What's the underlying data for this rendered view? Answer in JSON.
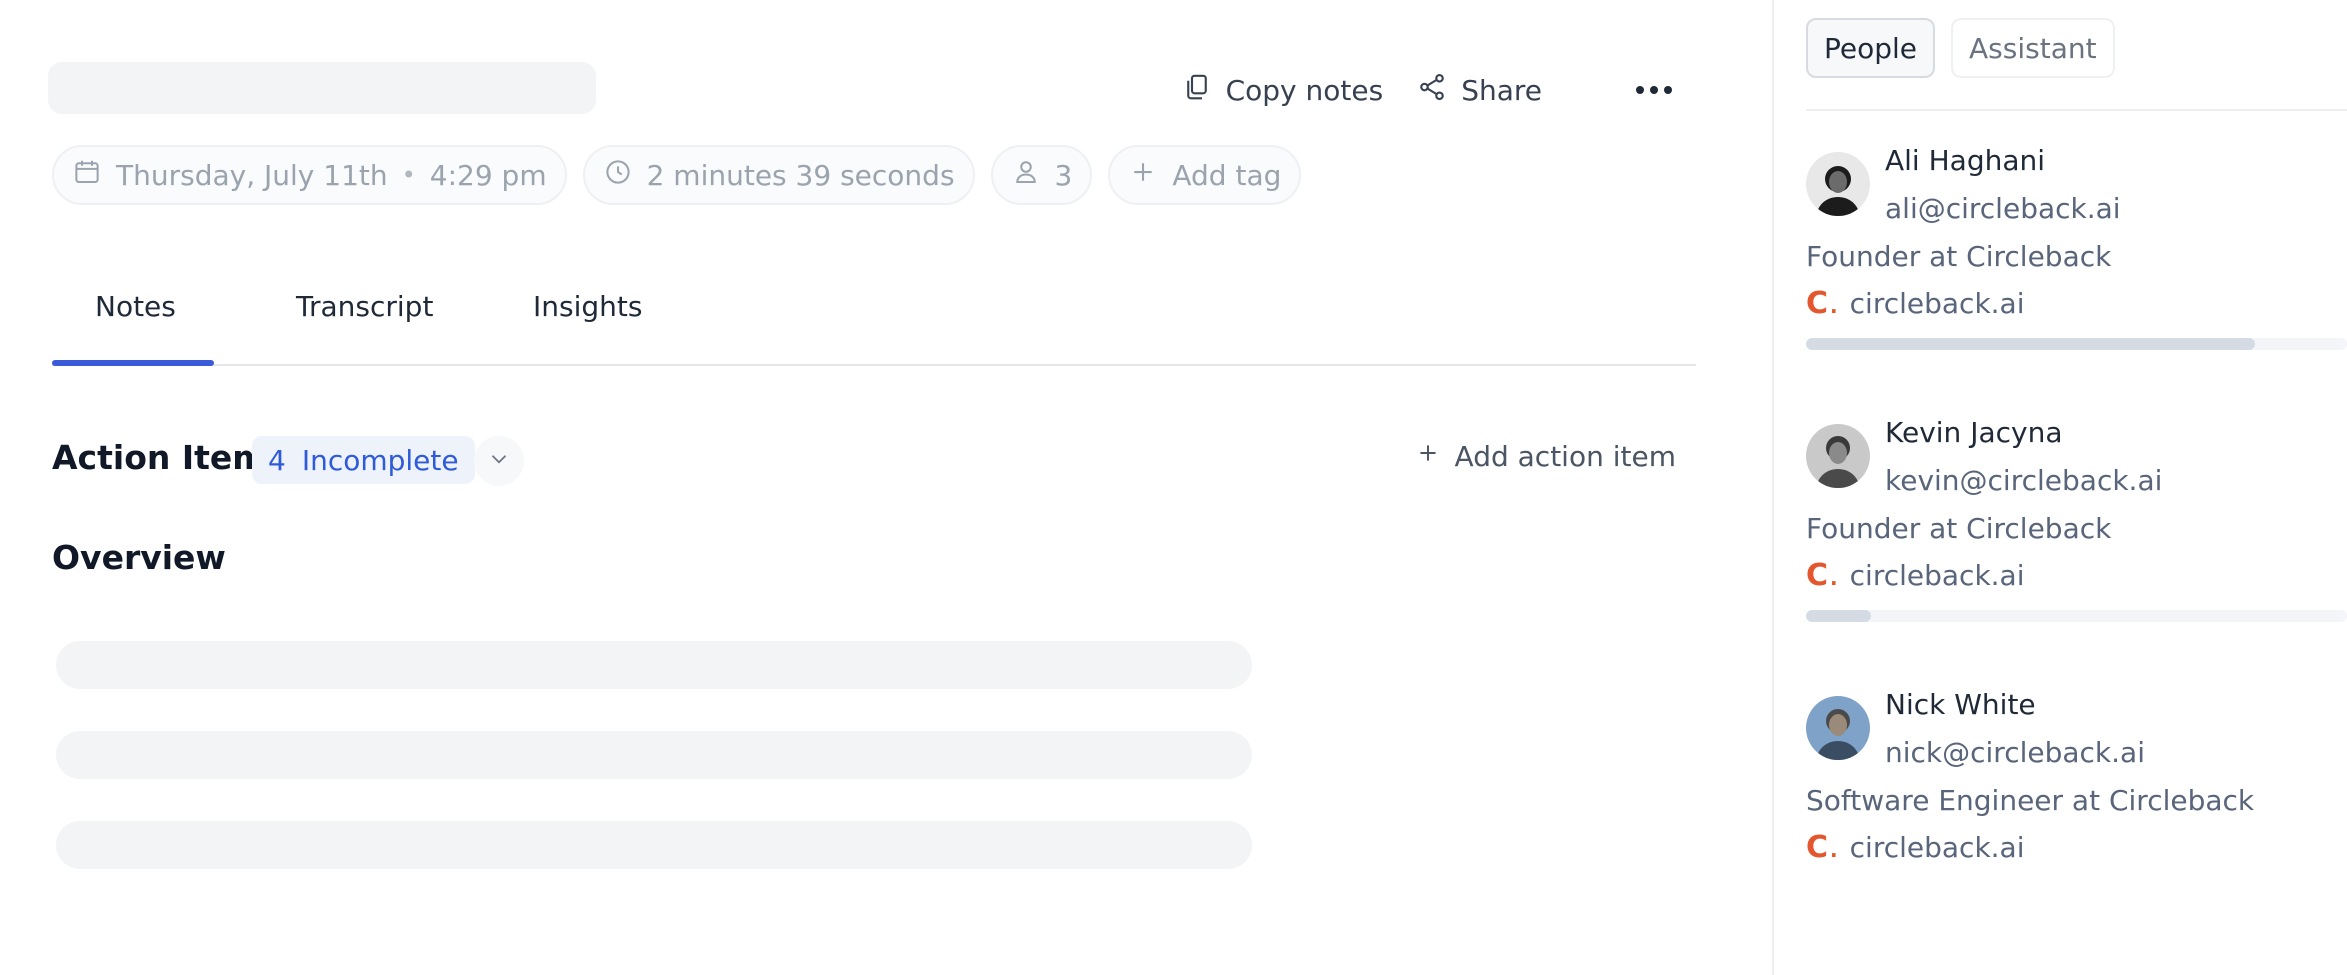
{
  "header": {
    "copy_notes": "Copy notes",
    "share": "Share"
  },
  "meta": {
    "date": "Thursday, July 11th",
    "separator": "•",
    "time": "4:29 pm",
    "duration": "2 minutes 39 seconds",
    "attendees": "3",
    "add_tag": "Add tag"
  },
  "tabs": [
    {
      "label": "Notes",
      "active": true
    },
    {
      "label": "Transcript",
      "active": false
    },
    {
      "label": "Insights",
      "active": false
    }
  ],
  "action_items": {
    "title": "Action Items",
    "count": "4",
    "status": "Incomplete",
    "add_label": "Add action item"
  },
  "overview": {
    "title": "Overview"
  },
  "sidebar": {
    "tabs": [
      {
        "label": "People",
        "active": true
      },
      {
        "label": "Assistant",
        "active": false
      }
    ],
    "people": [
      {
        "name": "Ali Haghani",
        "email": "ali@circleback.ai",
        "role": "Founder at Circleback",
        "company": "circleback.ai",
        "activity": 0.83
      },
      {
        "name": "Kevin Jacyna",
        "email": "kevin@circleback.ai",
        "role": "Founder at Circleback",
        "company": "circleback.ai",
        "activity": 0.12
      },
      {
        "name": "Nick White",
        "email": "nick@circleback.ai",
        "role": "Software Engineer at Circleback",
        "company": "circleback.ai"
      }
    ]
  },
  "colors": {
    "accent": "#3b5bdb",
    "badge_text": "#2f5bd8",
    "brand_logo": "#e4572e"
  },
  "icons": {
    "copy": "copy-icon",
    "share": "share-icon",
    "more": "more-horizontal-icon",
    "calendar": "calendar-icon",
    "clock": "clock-icon",
    "person": "person-icon",
    "plus": "plus-icon",
    "chevron": "chevron-down-icon"
  }
}
